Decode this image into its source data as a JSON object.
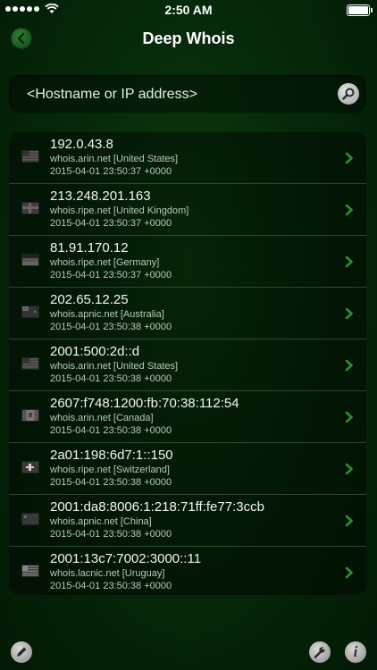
{
  "status_bar": {
    "time": "2:50 AM"
  },
  "nav": {
    "title": "Deep Whois",
    "back_icon": "chevron-left-icon"
  },
  "search": {
    "placeholder": "<Hostname or IP address>",
    "icon": "search-icon"
  },
  "colors": {
    "background": "#06290a",
    "chevron": "#2f8f32",
    "text": "#f2f7f2"
  },
  "results": [
    {
      "flag": "us",
      "host": "192.0.43.8",
      "server": "whois.arin.net [United States]",
      "date": "2015-04-01 23:50:37 +0000"
    },
    {
      "flag": "gb",
      "host": "213.248.201.163",
      "server": "whois.ripe.net [United Kingdom]",
      "date": "2015-04-01 23:50:37 +0000"
    },
    {
      "flag": "de",
      "host": "81.91.170.12",
      "server": "whois.ripe.net [Germany]",
      "date": "2015-04-01 23:50:37 +0000"
    },
    {
      "flag": "au",
      "host": "202.65.12.25",
      "server": "whois.apnic.net [Australia]",
      "date": "2015-04-01 23:50:38 +0000"
    },
    {
      "flag": "us",
      "host": "2001:500:2d::d",
      "server": "whois.arin.net [United States]",
      "date": "2015-04-01 23:50:38 +0000"
    },
    {
      "flag": "ca",
      "host": "2607:f748:1200:fb:70:38:112:54",
      "server": "whois.arin.net [Canada]",
      "date": "2015-04-01 23:50:38 +0000"
    },
    {
      "flag": "ch",
      "host": "2a01:198:6d7:1::150",
      "server": "whois.ripe.net [Switzerland]",
      "date": "2015-04-01 23:50:38 +0000"
    },
    {
      "flag": "cn",
      "host": "2001:da8:8006:1:218:71ff:fe77:3ccb",
      "server": "whois.apnic.net [China]",
      "date": "2015-04-01 23:50:38 +0000"
    },
    {
      "flag": "uy",
      "host": "2001:13c7:7002:3000::11",
      "server": "whois.lacnic.net [Uruguay]",
      "date": "2015-04-01 23:50:38 +0000"
    }
  ],
  "toolbar": {
    "edit_icon": "pencil-icon",
    "settings_icon": "wrench-icon",
    "info_icon": "info-icon",
    "info_glyph": "i"
  }
}
